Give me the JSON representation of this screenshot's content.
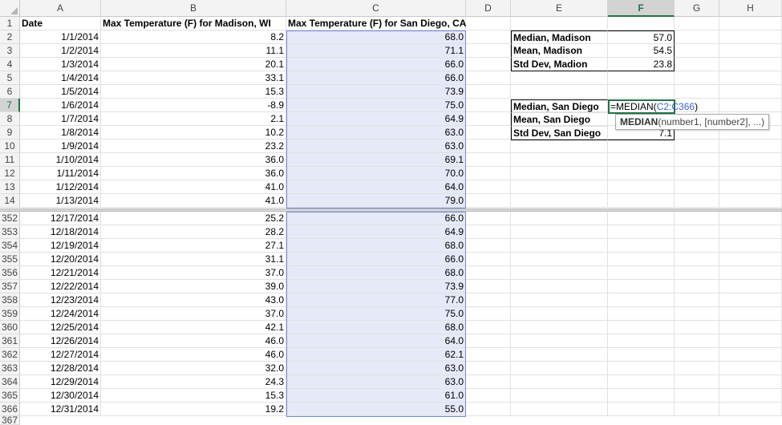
{
  "columns": [
    "A",
    "B",
    "C",
    "D",
    "E",
    "F",
    "G",
    "H"
  ],
  "selected_column": "F",
  "selected_row": "7",
  "headers": {
    "date": "Date",
    "madison": "Max Temperature (F) for Madison, WI",
    "sandiego": "Max Temperature (F) for San Diego, CA"
  },
  "top_rows": [
    {
      "num": "2",
      "date": "1/1/2014",
      "mad": "8.2",
      "sd": "68.0"
    },
    {
      "num": "3",
      "date": "1/2/2014",
      "mad": "11.1",
      "sd": "71.1"
    },
    {
      "num": "4",
      "date": "1/3/2014",
      "mad": "20.1",
      "sd": "66.0"
    },
    {
      "num": "5",
      "date": "1/4/2014",
      "mad": "33.1",
      "sd": "66.0"
    },
    {
      "num": "6",
      "date": "1/5/2014",
      "mad": "15.3",
      "sd": "73.9"
    },
    {
      "num": "7",
      "date": "1/6/2014",
      "mad": "-8.9",
      "sd": "75.0"
    },
    {
      "num": "8",
      "date": "1/7/2014",
      "mad": "2.1",
      "sd": "64.9"
    },
    {
      "num": "9",
      "date": "1/8/2014",
      "mad": "10.2",
      "sd": "63.0"
    },
    {
      "num": "10",
      "date": "1/9/2014",
      "mad": "23.2",
      "sd": "63.0"
    },
    {
      "num": "11",
      "date": "1/10/2014",
      "mad": "36.0",
      "sd": "69.1"
    },
    {
      "num": "12",
      "date": "1/11/2014",
      "mad": "36.0",
      "sd": "70.0"
    },
    {
      "num": "13",
      "date": "1/12/2014",
      "mad": "41.0",
      "sd": "64.0"
    },
    {
      "num": "14",
      "date": "1/13/2014",
      "mad": "41.0",
      "sd": "79.0"
    }
  ],
  "bottom_rows": [
    {
      "num": "352",
      "date": "12/17/2014",
      "mad": "25.2",
      "sd": "66.0"
    },
    {
      "num": "353",
      "date": "12/18/2014",
      "mad": "28.2",
      "sd": "64.9"
    },
    {
      "num": "354",
      "date": "12/19/2014",
      "mad": "27.1",
      "sd": "68.0"
    },
    {
      "num": "355",
      "date": "12/20/2014",
      "mad": "31.1",
      "sd": "66.0"
    },
    {
      "num": "356",
      "date": "12/21/2014",
      "mad": "37.0",
      "sd": "68.0"
    },
    {
      "num": "357",
      "date": "12/22/2014",
      "mad": "39.0",
      "sd": "73.9"
    },
    {
      "num": "358",
      "date": "12/23/2014",
      "mad": "43.0",
      "sd": "77.0"
    },
    {
      "num": "359",
      "date": "12/24/2014",
      "mad": "37.0",
      "sd": "75.0"
    },
    {
      "num": "360",
      "date": "12/25/2014",
      "mad": "42.1",
      "sd": "68.0"
    },
    {
      "num": "361",
      "date": "12/26/2014",
      "mad": "46.0",
      "sd": "64.0"
    },
    {
      "num": "362",
      "date": "12/27/2014",
      "mad": "46.0",
      "sd": "62.1"
    },
    {
      "num": "363",
      "date": "12/28/2014",
      "mad": "32.0",
      "sd": "63.0"
    },
    {
      "num": "364",
      "date": "12/29/2014",
      "mad": "24.3",
      "sd": "63.0"
    },
    {
      "num": "365",
      "date": "12/30/2014",
      "mad": "15.3",
      "sd": "61.0"
    },
    {
      "num": "366",
      "date": "12/31/2014",
      "mad": "19.2",
      "sd": "55.0"
    }
  ],
  "partial_row_num": "367",
  "stats": {
    "median_madison_label": "Median, Madison",
    "median_madison_value": "57.0",
    "mean_madison_label": "Mean, Madison",
    "mean_madison_value": "54.5",
    "std_madison_label": "Std Dev, Madion",
    "std_madison_value": "23.8",
    "median_sd_label": "Median, San Diego",
    "mean_sd_label": "Mean, San Diego",
    "std_sd_label": "Std Dev, San Diego",
    "std_sd_value": "7.1"
  },
  "formula": {
    "prefix": "=MEDIAN(",
    "range": "C2:C366",
    "suffix": ")"
  },
  "tooltip": {
    "fn": "MEDIAN",
    "args": "(number1, [number2], ...)"
  }
}
